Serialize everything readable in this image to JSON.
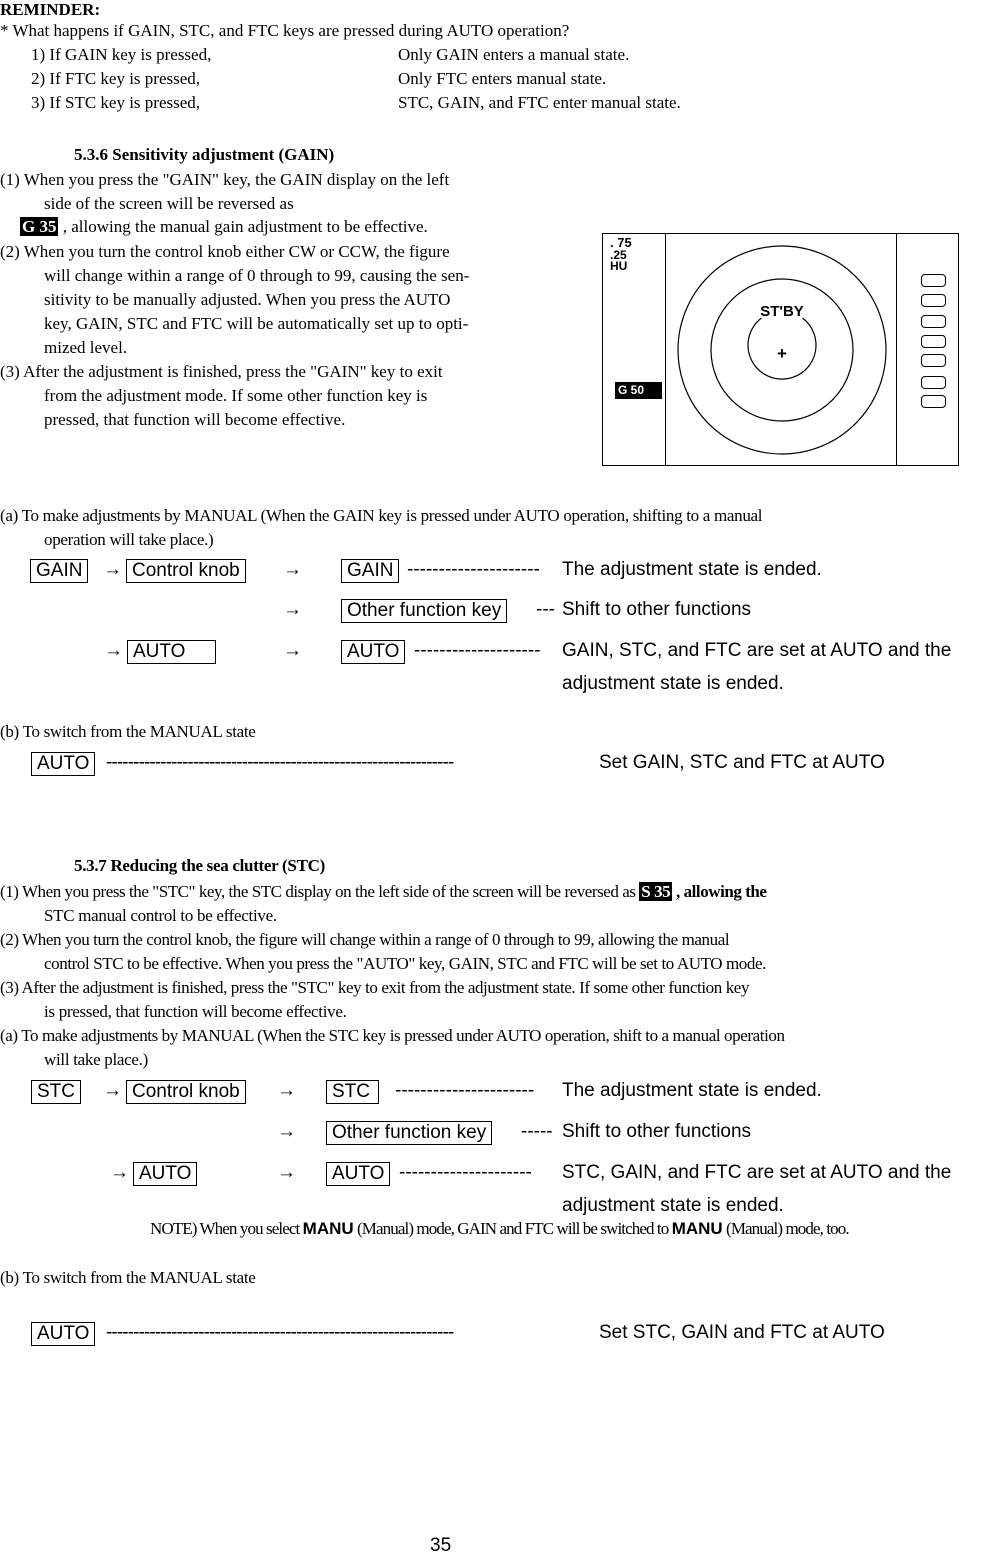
{
  "reminder": {
    "title": "REMINDER:",
    "question": "* What happens if GAIN, STC, and FTC keys are pressed during AUTO operation?",
    "items": [
      {
        "condition": "1) If GAIN key is pressed,",
        "result": "Only GAIN enters a manual state."
      },
      {
        "condition": "2) If FTC key is pressed,",
        "result": "Only FTC enters manual state."
      },
      {
        "condition": "3) If STC key is pressed,",
        "result": "STC, GAIN, and FTC enter manual state."
      }
    ]
  },
  "gain_section": {
    "heading": "5.3.6 Sensitivity adjustment (GAIN)",
    "p1_line1": "(1) When you press the \"GAIN\" key, the GAIN display on the left",
    "p1_line2": "side of the screen will be reversed as",
    "p1_badge": "G 35",
    "p1_line3": " , allowing the manual gain adjustment to be effective.",
    "p2_lines": [
      "(2) When you turn the control knob either CW or CCW, the figure",
      "will change within a range of 0 through to 99, causing the sen-",
      "sitivity to be manually adjusted.  When you press the AUTO",
      "key, GAIN, STC and FTC will be automatically set up to opti-",
      "mized level."
    ],
    "p3_lines": [
      "(3) After the adjustment is finished, press the \"GAIN\" key to exit",
      "from the adjustment mode.  If some other function key is",
      "pressed, that function will become effective."
    ],
    "a_line1": "(a) To make adjustments by MANUAL (When the GAIN key is pressed under AUTO operation, shifting to a manual",
    "a_line2": "operation will take place.)",
    "flow": {
      "start_key": "GAIN",
      "arrow": "→",
      "knob_key": "Control knob",
      "auto_key": "AUTO",
      "row1_key": "GAIN",
      "row1_dashes": "---------------------",
      "row1_result": "The adjustment state is ended.",
      "row2_key": "Other function key",
      "row2_dashes": "---",
      "row2_result": "Shift to other functions",
      "row3_key": "AUTO",
      "row3_dashes": "--------------------",
      "row3_result_1": "GAIN, STC, and FTC are set at AUTO and the",
      "row3_result_2": "adjustment state is ended."
    },
    "b_line": "(b) To switch from the MANUAL state",
    "b_key": "AUTO",
    "b_dashes": "----------------------------------------------------------------",
    "b_result": "Set GAIN, STC and FTC at AUTO"
  },
  "radar_display": {
    "range_1": ". 75",
    "range_2": ".25",
    "mode": "HU",
    "gain_badge": "G 50",
    "status": "ST'BY",
    "center_mark": "+",
    "softkey_count": 7
  },
  "stc_section": {
    "heading": "5.3.7 Reducing the sea clutter (STC)",
    "p1_line1_pre": "(1) When you press the \"STC\" key, the STC display on the left side of the screen will be reversed as ",
    "p1_badge": "S 35",
    "p1_line1_post": " , allowing the",
    "p1_line2": "STC manual control to be effective.",
    "p2_lines": [
      "(2) When you turn the control knob, the figure will change within a range of 0 through to 99, allowing the manual",
      "control STC to be effective.  When you press the \"AUTO\" key, GAIN, STC and FTC will be set to AUTO mode."
    ],
    "p3_lines": [
      "(3) After the adjustment is finished, press the \"STC\" key to exit from the adjustment state.  If some other function key",
      "is pressed, that function will become effective."
    ],
    "a_lines": [
      "(a) To make adjustments by MANUAL (When the STC key is pressed under AUTO operation, shift to a manual operation",
      "will take place.)"
    ],
    "flow": {
      "start_key": "STC",
      "arrow": "→",
      "knob_key": "Control knob",
      "auto_key": "AUTO",
      "row1_key": "STC",
      "row1_dashes": "----------------------",
      "row1_result": "The adjustment state is ended.",
      "row2_key": "Other function key",
      "row2_dashes": "-----",
      "row2_result": "Shift to other functions",
      "row3_key": "AUTO",
      "row3_dashes": "---------------------",
      "row3_result_1": "STC, GAIN, and FTC are set at AUTO and the",
      "row3_result_2": "adjustment state is ended."
    },
    "note_pre": "NOTE) When you select ",
    "note_manu_1": "MANU",
    "note_mid": " (Manual) mode, GAIN and FTC will be switched to ",
    "note_manu_2": "MANU",
    "note_post": " (Manual) mode, too.",
    "b_line": "(b)  To switch from the MANUAL state",
    "b_key": "AUTO",
    "b_dashes": "----------------------------------------------------------------",
    "b_result": "Set STC, GAIN and FTC at AUTO"
  },
  "page_number": "35"
}
